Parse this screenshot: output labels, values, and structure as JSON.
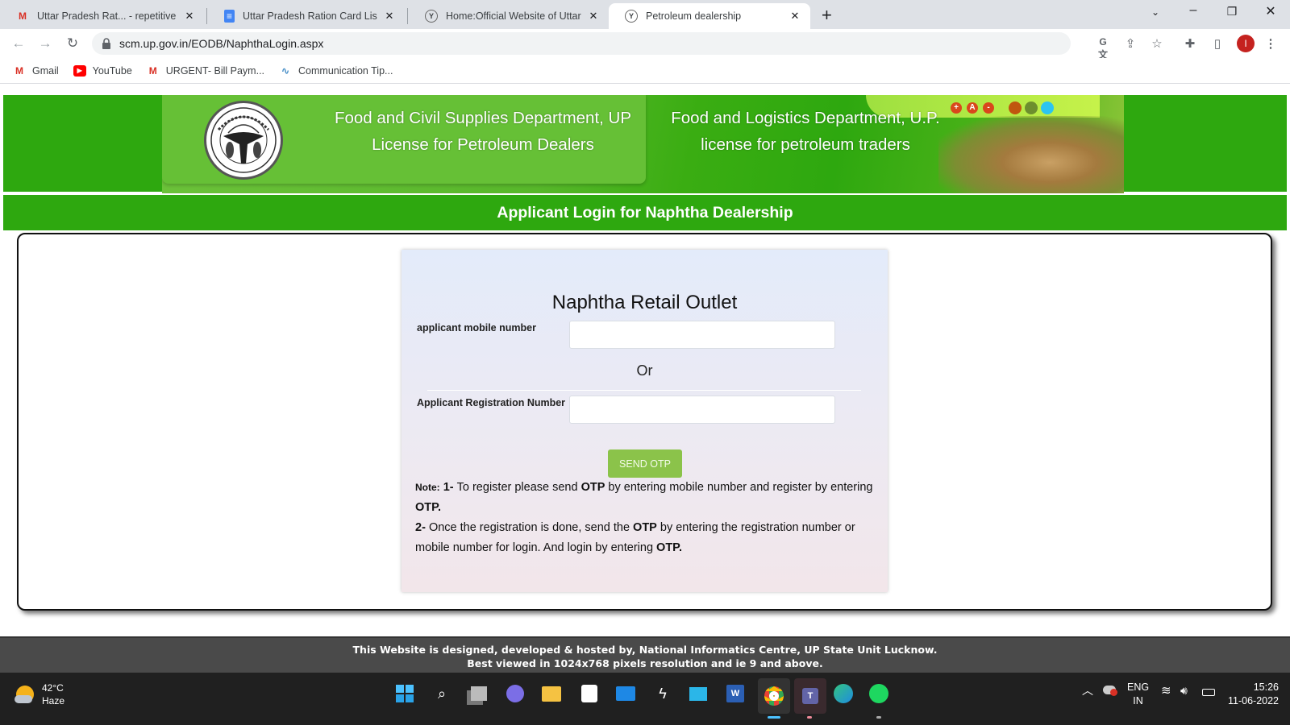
{
  "browser": {
    "tabs": [
      {
        "label": "Uttar Pradesh Rat... - repetitive -",
        "icon": "gmail-icon",
        "active": false
      },
      {
        "label": "Uttar Pradesh Ration Card List - C",
        "icon": "docs-icon",
        "active": false
      },
      {
        "label": "Home:Official Website of Uttar Pr",
        "icon": "up-emblem-icon",
        "active": false
      },
      {
        "label": "Petroleum dealership",
        "icon": "up-emblem-icon",
        "active": true
      }
    ],
    "url": "scm.up.gov.in/EODB/NaphthaLogin.aspx",
    "profile_initial": "I",
    "bookmarks": [
      {
        "label": "Gmail",
        "icon": "gmail-icon"
      },
      {
        "label": "YouTube",
        "icon": "youtube-icon"
      },
      {
        "label": "URGENT- Bill Paym...",
        "icon": "gmail-icon"
      },
      {
        "label": "Communication Tip...",
        "icon": "chart-icon"
      }
    ]
  },
  "banner": {
    "left_title": "Food and Civil Supplies Department, UP",
    "left_subtitle": "License for Petroleum Dealers",
    "right_title": "Food and Logistics Department, U.P.",
    "right_subtitle": "license for petroleum traders",
    "font_controls": [
      "+",
      "A",
      "-"
    ],
    "theme_colors": [
      "#c0560f",
      "#6d8e2e",
      "#2cc4f0"
    ]
  },
  "login_bar": {
    "title": "Applicant Login for Naphtha Dealership"
  },
  "form": {
    "heading": "Naphtha Retail Outlet",
    "mobile_label": "applicant mobile number",
    "mobile_value": "",
    "or_text": "Or",
    "registration_label": "Applicant Registration Number",
    "registration_value": "",
    "send_otp_label": "SEND OTP",
    "note_label": "Note:",
    "note_1_prefix": "1-",
    "note_1_a": "To register please send ",
    "note_1_b": "OTP",
    "note_1_c": " by entering mobile number and register by entering ",
    "note_1_d": "OTP.",
    "note_2_prefix": "2-",
    "note_2_a": "Once the registration is done, send the ",
    "note_2_b": "OTP",
    "note_2_c": " by entering the registration number or mobile number for login. And login by entering ",
    "note_2_d": "OTP."
  },
  "footer": {
    "line1": "This Website is designed, developed & hosted by, National Informatics Centre, UP State Unit Lucknow.",
    "line2": "Best viewed in 1024x768 pixels resolution and ie 9 and above."
  },
  "taskbar": {
    "weather_temp": "42°C",
    "weather_desc": "Haze",
    "language": "ENG",
    "region": "IN",
    "time": "15:26",
    "date": "11-06-2022",
    "apps": [
      "start",
      "search",
      "task-view",
      "chat",
      "file-explorer",
      "store",
      "mail",
      "app-lightning",
      "monitor",
      "word",
      "chrome",
      "teams",
      "edge",
      "spotify"
    ]
  }
}
